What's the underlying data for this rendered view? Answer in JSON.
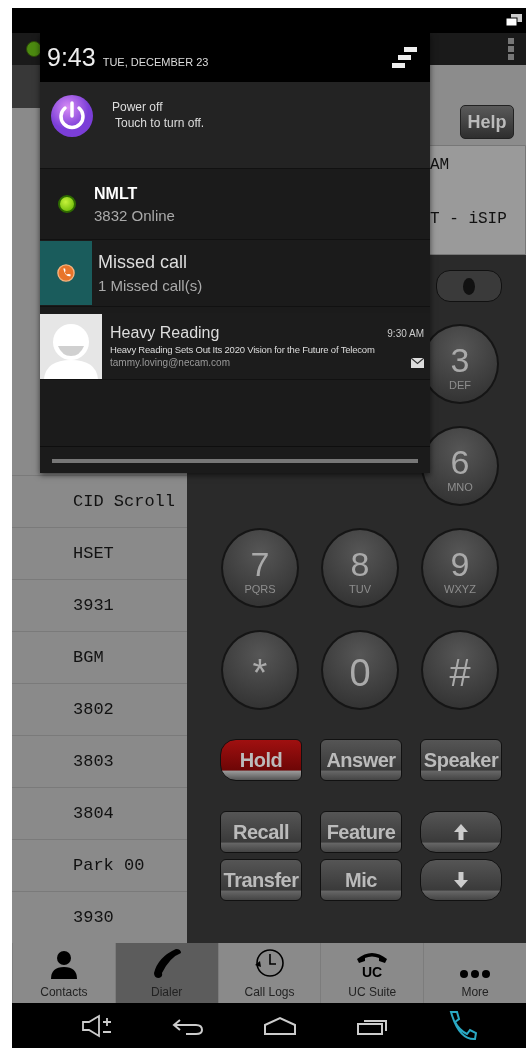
{
  "help_button": "Help",
  "display": {
    "line_1": "AM",
    "line_2": "T - iSIP"
  },
  "side_list": [
    "CID Scroll",
    "HSET",
    "3931",
    "BGM",
    "3802",
    "3803",
    "3804",
    "Park 00",
    "3930"
  ],
  "keypad_rows": [
    {
      "keys": [
        {
          "digit": "3",
          "letters": "DEF"
        }
      ]
    },
    {
      "keys": [
        {
          "digit": "6",
          "letters": "MNO"
        }
      ]
    },
    {
      "keys": [
        {
          "digit": "7",
          "letters": "PQRS"
        },
        {
          "digit": "8",
          "letters": "TUV"
        },
        {
          "digit": "9",
          "letters": "WXYZ"
        }
      ]
    },
    {
      "keys": [
        {
          "digit": "*"
        },
        {
          "digit": "0"
        },
        {
          "digit": "#"
        }
      ]
    }
  ],
  "function_buttons": [
    {
      "kind": "red",
      "label": "Hold"
    },
    {
      "kind": "text",
      "label": "Answer"
    },
    {
      "kind": "text",
      "label": "Speaker"
    },
    {
      "kind": "text",
      "label": "Recall"
    },
    {
      "kind": "text",
      "label": "Feature"
    },
    {
      "kind": "up"
    },
    {
      "kind": "text",
      "label": "Transfer"
    },
    {
      "kind": "text",
      "label": "Mic"
    },
    {
      "kind": "down"
    }
  ],
  "tabs": [
    {
      "kind": "contacts",
      "label": "Contacts",
      "selected": false
    },
    {
      "kind": "dialer",
      "label": "Dialer",
      "selected": true
    },
    {
      "kind": "logs",
      "label": "Call Logs",
      "selected": false
    },
    {
      "kind": "uc",
      "label": "UC Suite",
      "icon_text": "UC",
      "selected": false
    },
    {
      "kind": "more",
      "label": "More",
      "selected": false
    }
  ],
  "notification_shade": {
    "time": "9:43",
    "date": "TUE, DECEMBER 23",
    "notifications": [
      {
        "kind": "power",
        "title": "Power off",
        "text": "Touch to turn off."
      },
      {
        "kind": "presence",
        "title": "NMLT",
        "text": "3832 Online"
      },
      {
        "kind": "missed_call",
        "title": "Missed call",
        "text": "1 Missed call(s)"
      },
      {
        "kind": "email",
        "title": "Heavy Reading",
        "time": "9:30 AM",
        "text": "Heavy Reading Sets Out Its 2020 Vision for the Future of Telecom",
        "sender": "tammy.loving@necam.com"
      }
    ]
  }
}
